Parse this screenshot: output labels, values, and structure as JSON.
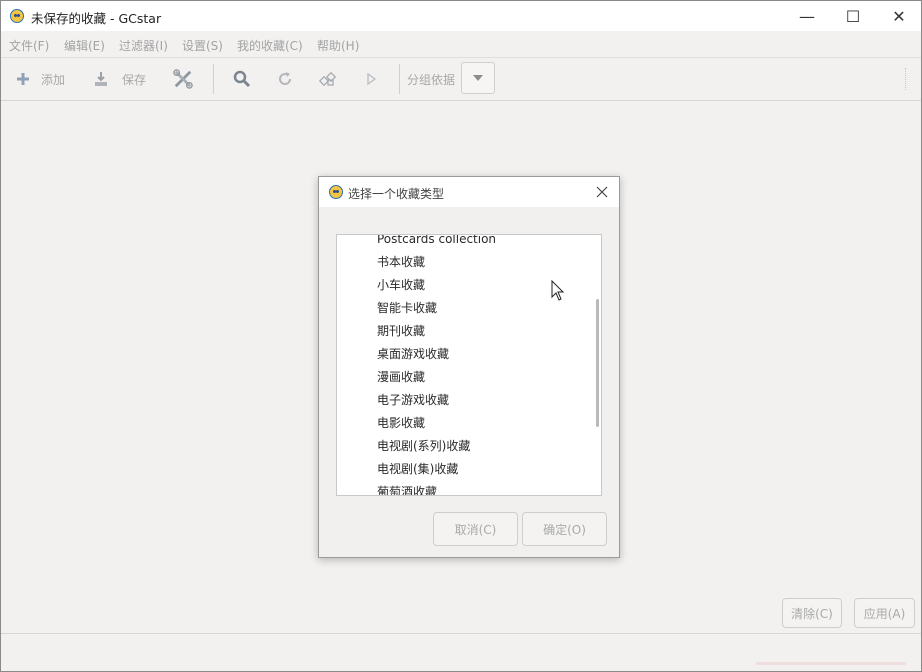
{
  "window": {
    "title": "未保存的收藏 - GCstar",
    "controls": {
      "minimize": "—",
      "maximize": "☐",
      "close": "✕"
    }
  },
  "menu": [
    {
      "label": "文件(F)"
    },
    {
      "label": "编辑(E)"
    },
    {
      "label": "过滤器(I)"
    },
    {
      "label": "设置(S)"
    },
    {
      "label": "我的收藏(C)"
    },
    {
      "label": "帮助(H)"
    }
  ],
  "toolbar": {
    "add_label": "添加",
    "save_label": "保存",
    "group_by_label": "分组依据",
    "icons": [
      "plus-icon",
      "save-icon",
      "tools-icon",
      "search-icon",
      "refresh-icon",
      "random-icon",
      "play-icon",
      "chevron-down-icon"
    ]
  },
  "bottom": {
    "clear_label": "清除(C)",
    "apply_label": "应用(A)",
    "progress": 0.0
  },
  "dialog": {
    "title": "选择一个收藏类型",
    "items": [
      "Postcards collection",
      "书本收藏",
      "小车收藏",
      "智能卡收藏",
      "期刊收藏",
      "桌面游戏收藏",
      "漫画收藏",
      "电子游戏收藏",
      "电影收藏",
      "电视剧(系列)收藏",
      "电视剧(集)收藏",
      "葡萄酒收藏"
    ],
    "cancel_label": "取消(C)",
    "ok_label": "确定(O)"
  },
  "colors": {
    "background": "#f2f1f0",
    "disabled_text": "#a8a8a8",
    "app_icon_yellow": "#f4c542",
    "app_icon_blue": "#2a6fb7"
  }
}
